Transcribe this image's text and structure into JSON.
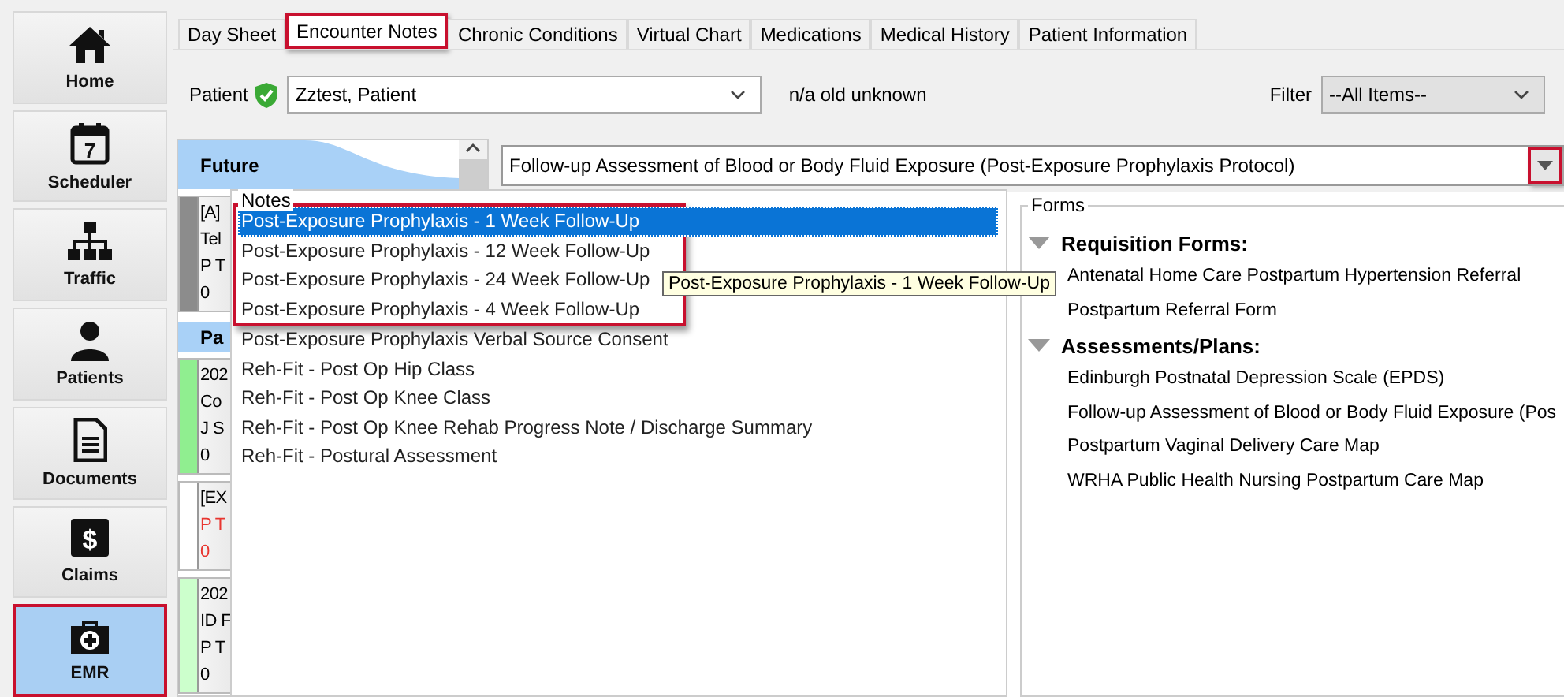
{
  "nav": [
    {
      "label": "Home",
      "selected": false,
      "highlighted": false
    },
    {
      "label": "Scheduler",
      "glyph": "7",
      "selected": false,
      "highlighted": false
    },
    {
      "label": "Traffic",
      "selected": false,
      "highlighted": false
    },
    {
      "label": "Patients",
      "selected": false,
      "highlighted": false
    },
    {
      "label": "Documents",
      "selected": false,
      "highlighted": false
    },
    {
      "label": "Claims",
      "glyph": "$",
      "selected": false,
      "highlighted": false
    },
    {
      "label": "EMR",
      "selected": true,
      "highlighted": true
    }
  ],
  "tabs": [
    {
      "label": "Day Sheet",
      "selected": false,
      "highlighted": false
    },
    {
      "label": "Encounter Notes",
      "selected": true,
      "highlighted": true
    },
    {
      "label": "Chronic Conditions",
      "selected": false,
      "highlighted": false
    },
    {
      "label": "Virtual Chart",
      "selected": false,
      "highlighted": false
    },
    {
      "label": "Medications",
      "selected": false,
      "highlighted": false
    },
    {
      "label": "Medical History",
      "selected": false,
      "highlighted": false
    },
    {
      "label": "Patient Information",
      "selected": false,
      "highlighted": false
    }
  ],
  "patient": {
    "label": "Patient",
    "verified": true,
    "value": "Zztest, Patient",
    "info": "n/a old unknown"
  },
  "filter": {
    "label": "Filter",
    "value": "--All Items--"
  },
  "appointments": [
    {
      "title": "Future",
      "kind": "wave",
      "cards": [
        {
          "color": "#8c8c8c",
          "flagged": false,
          "lines": [
            "[A]",
            "Tel",
            "P T",
            "0"
          ]
        }
      ]
    },
    {
      "title": "Pa",
      "kind": "plain",
      "cards": [
        {
          "color": "#90ee90",
          "flagged": false,
          "lines": [
            "202",
            "Co",
            "J S",
            "0"
          ]
        },
        {
          "color": "#ffffff",
          "flagged": true,
          "lines": [
            "[EX",
            "P T",
            "0"
          ]
        },
        {
          "color": "#ccffcc",
          "flagged": false,
          "lines": [
            "202",
            "ID F",
            "P T",
            "0"
          ]
        }
      ]
    }
  ],
  "template_select": {
    "value": "Follow-up Assessment of Blood or Body Fluid Exposure (Post-Exposure Prophylaxis Protocol)",
    "highlighted": true
  },
  "notes": {
    "label": "Notes",
    "items": [
      {
        "text": "Post-Exposure Prophylaxis - 1 Week Follow-Up",
        "selected": true,
        "highlighted": true
      },
      {
        "text": "Post-Exposure Prophylaxis - 12 Week Follow-Up",
        "selected": false,
        "highlighted": true
      },
      {
        "text": "Post-Exposure Prophylaxis - 24 Week Follow-Up",
        "selected": false,
        "highlighted": true
      },
      {
        "text": "Post-Exposure Prophylaxis - 4 Week Follow-Up",
        "selected": false,
        "highlighted": true
      },
      {
        "text": "Post-Exposure Prophylaxis Verbal Source Consent",
        "selected": false,
        "highlighted": false
      },
      {
        "text": "Reh-Fit - Post Op Hip Class",
        "selected": false,
        "highlighted": false
      },
      {
        "text": "Reh-Fit - Post Op Knee Class",
        "selected": false,
        "highlighted": false
      },
      {
        "text": "Reh-Fit - Post Op Knee Rehab Progress Note / Discharge Summary",
        "selected": false,
        "highlighted": false
      },
      {
        "text": "Reh-Fit - Postural Assessment",
        "selected": false,
        "highlighted": false
      }
    ]
  },
  "tooltip": "Post-Exposure Prophylaxis - 1 Week Follow-Up",
  "forms": {
    "label": "Forms",
    "groups": [
      {
        "title": "Requisition Forms:",
        "expanded": true,
        "items": [
          "Antenatal Home Care Postpartum Hypertension Referral",
          "Postpartum Referral Form"
        ]
      },
      {
        "title": "Assessments/Plans:",
        "expanded": true,
        "items": [
          "Edinburgh Postnatal Depression Scale (EPDS)",
          "Follow-up Assessment of Blood or Body Fluid Exposure (Pos",
          "Postpartum Vaginal Delivery Care Map",
          "WRHA Public Health Nursing Postpartum Care Map"
        ]
      }
    ]
  }
}
